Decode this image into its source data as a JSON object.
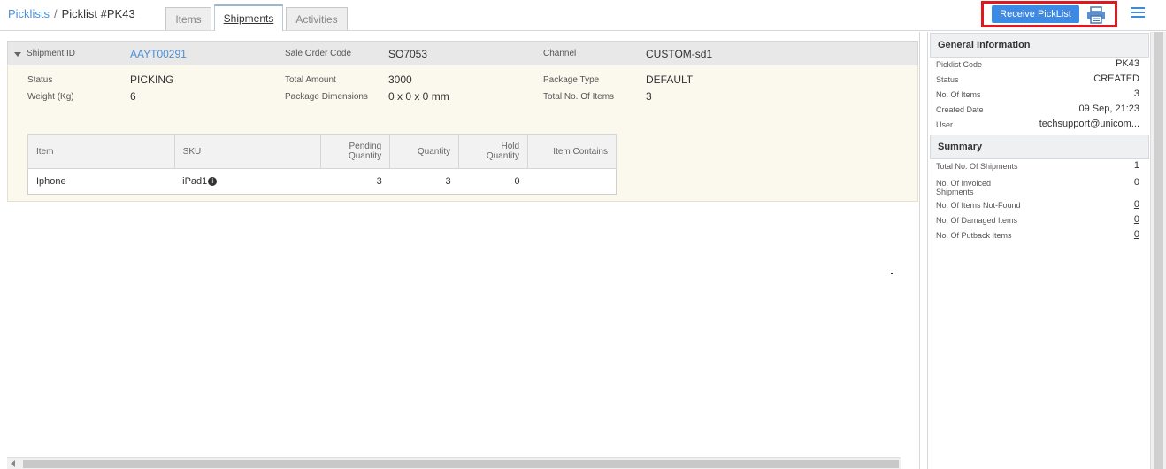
{
  "breadcrumb": {
    "root": "Picklists",
    "separator": "/",
    "current": "Picklist #PK43"
  },
  "tabs": [
    {
      "label": "Items"
    },
    {
      "label": "Shipments"
    },
    {
      "label": "Activities"
    }
  ],
  "toolbar": {
    "receive_label": "Receive PickList",
    "print_icon": "printer-icon",
    "menu_icon": "hamburger-menu-icon"
  },
  "shipment": {
    "id_label": "Shipment ID",
    "id_value": "AAYT00291",
    "sale_order_label": "Sale Order Code",
    "sale_order_value": "SO7053",
    "channel_label": "Channel",
    "channel_value": "CUSTOM-sd1",
    "status_label": "Status",
    "status_value": "PICKING",
    "total_amount_label": "Total Amount",
    "total_amount_value": "3000",
    "package_type_label": "Package Type",
    "package_type_value": "DEFAULT",
    "weight_label": "Weight (Kg)",
    "weight_value": "6",
    "dimensions_label": "Package Dimensions",
    "dimensions_value": "0 x 0 x 0 mm",
    "total_items_label": "Total No. Of Items",
    "total_items_value": "3"
  },
  "items_table": {
    "headers": [
      "Item",
      "SKU",
      "Pending Quantity",
      "Quantity",
      "Hold Quantity",
      "Item Contains"
    ],
    "rows": [
      {
        "item": "Iphone",
        "sku": "iPad1",
        "pending": "3",
        "quantity": "3",
        "hold": "0",
        "contains": ""
      }
    ]
  },
  "general_info": {
    "title": "General Information",
    "rows": [
      {
        "label": "Picklist Code",
        "value": "PK43"
      },
      {
        "label": "Status",
        "value": "CREATED"
      },
      {
        "label": "No. Of Items",
        "value": "3"
      },
      {
        "label": "Created Date",
        "value": "09 Sep, 21:23"
      },
      {
        "label": "User",
        "value": "techsupport@unicom..."
      }
    ]
  },
  "summary": {
    "title": "Summary",
    "rows": [
      {
        "label": "Total No. Of Shipments",
        "value": "1"
      },
      {
        "label": "No. Of Invoiced Shipments",
        "value": "0"
      },
      {
        "label": "No. Of Items Not-Found",
        "value": "0"
      },
      {
        "label": "No. Of Damaged Items",
        "value": "0"
      },
      {
        "label": "No. Of Putback Items",
        "value": "0"
      }
    ]
  },
  "colors": {
    "accent": "#3d8ae5",
    "link": "#4a90d9",
    "highlight": "#e0171f",
    "panel_bg": "#fbf8ee"
  }
}
